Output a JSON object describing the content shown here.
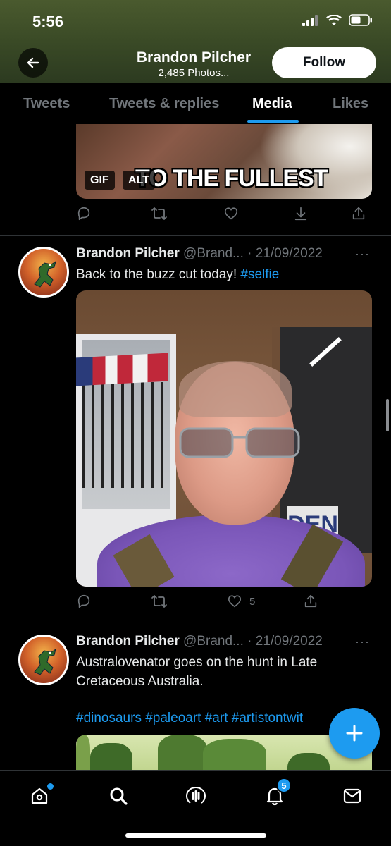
{
  "status_bar": {
    "time": "5:56"
  },
  "header": {
    "name": "Brandon Pilcher",
    "subtitle": "2,485 Photos...",
    "follow_label": "Follow"
  },
  "tabs": [
    {
      "label": "Tweets",
      "active": false
    },
    {
      "label": "Tweets & replies",
      "active": false
    },
    {
      "label": "Media",
      "active": true
    },
    {
      "label": "Likes",
      "active": false
    }
  ],
  "tweet1": {
    "gif_caption": "TO THE FULLEST",
    "gif_badge": "GIF",
    "alt_badge": "ALT"
  },
  "tweet2": {
    "name": "Brandon Pilcher",
    "handle": "@Brand...",
    "date": "· 21/09/2022",
    "text_main": "Back to the buzz cut today! ",
    "hashtag": "#selfie",
    "photo_sign": "DEN",
    "like_count": "5"
  },
  "tweet3": {
    "name": "Brandon Pilcher",
    "handle": "@Brand...",
    "date": "· 21/09/2022",
    "line1": "Australovenator goes on the hunt in Late",
    "line2": "Cretaceous Australia.",
    "hashtags": "#dinosaurs #paleoart #art #artistontwit"
  },
  "more_label": "···",
  "bottom_nav": {
    "notifications_count": "5"
  },
  "colors": {
    "accent": "#1d9bf0",
    "background": "#000000",
    "muted": "#71767b"
  },
  "icons": [
    "back-arrow-icon",
    "reply-icon",
    "retweet-icon",
    "like-icon",
    "download-icon",
    "share-icon",
    "compose-icon",
    "home-icon",
    "search-icon",
    "spaces-icon",
    "notifications-icon",
    "messages-icon"
  ]
}
